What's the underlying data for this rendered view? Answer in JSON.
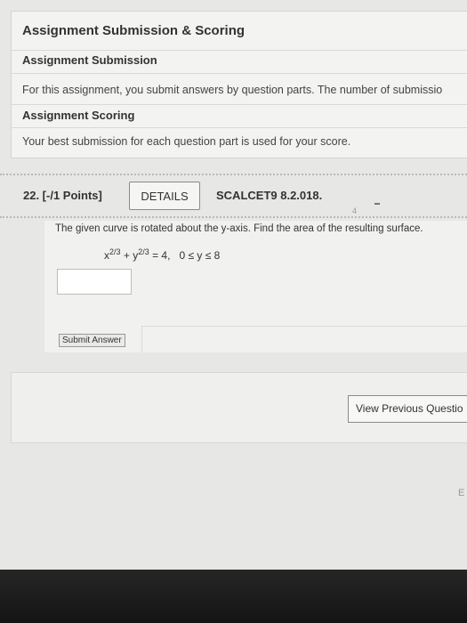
{
  "info_panel": {
    "title": "Assignment Submission & Scoring",
    "submission_heading": "Assignment Submission",
    "submission_text": "For this assignment, you submit answers by question parts. The number of submissio",
    "scoring_heading": "Assignment Scoring",
    "scoring_text": "Your best submission for each question part is used for your score."
  },
  "question": {
    "number_label": "22. [-/1 Points]",
    "details_label": "DETAILS",
    "code": "SCALCET9 8.2.018.",
    "smudge_mark": "4",
    "text": "The given curve is rotated about the y-axis. Find the area of the resulting surface.",
    "equation": {
      "x_base": "x",
      "x_exp": "2/3",
      "plus": "+",
      "y_base": "y",
      "y_exp": "2/3",
      "rhs": "= 4,",
      "range": "0 ≤ y ≤ 8"
    },
    "answer_value": "",
    "submit_label": "Submit Answer"
  },
  "footer": {
    "view_previous_label": "View Previous Questio",
    "edge_mark": "E"
  }
}
